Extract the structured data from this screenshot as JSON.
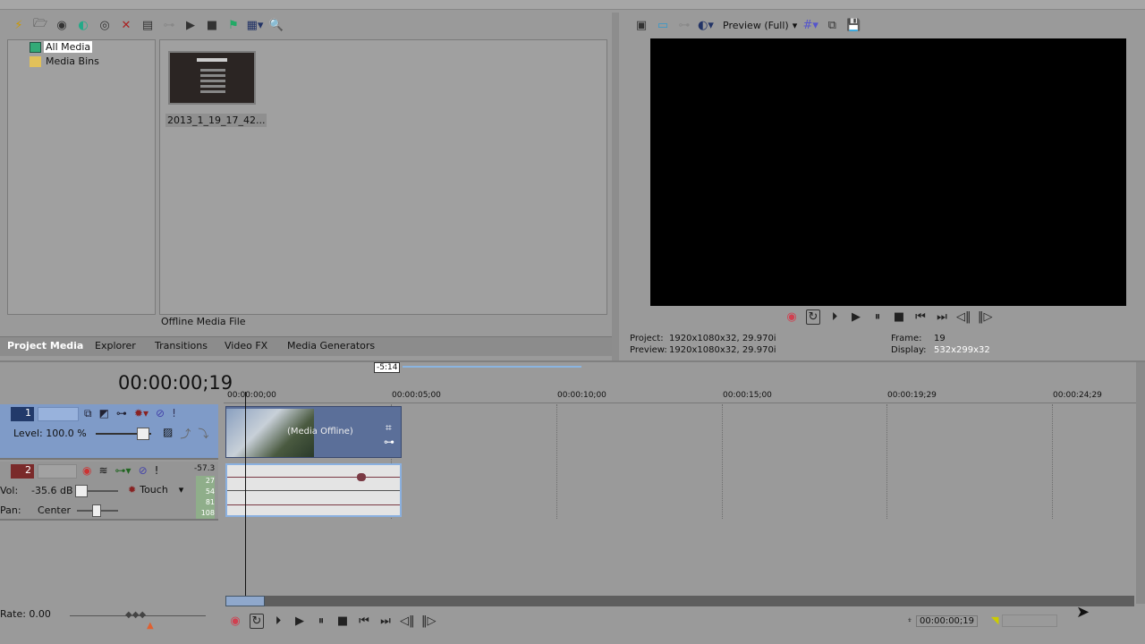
{
  "media": {
    "tree": [
      "All Media",
      "Media Bins"
    ],
    "thumbnail_label": "2013_1_19_17_42...",
    "status": "Offline Media File",
    "tabs": [
      "Project Media",
      "Explorer",
      "Transitions",
      "Video FX",
      "Media Generators"
    ]
  },
  "preview": {
    "mode": "Preview (Full)",
    "project_label": "Project:",
    "project_value": "1920x1080x32, 29.970i",
    "preview_label": "Preview:",
    "preview_value": "1920x1080x32, 29.970i",
    "frame_label": "Frame:",
    "frame_value": "19",
    "display_label": "Display:",
    "display_value": "532x299x32"
  },
  "timeline": {
    "time": "00:00:00;19",
    "selection_length": "-5:14",
    "ruler": [
      "00:00:00;00",
      "00:00:05;00",
      "00:00:10;00",
      "00:00:15;00",
      "00:00:19;29",
      "00:00:24;29"
    ],
    "video_track": {
      "number": "1",
      "level": "Level: 100.0 %"
    },
    "audio_track": {
      "number": "2",
      "vol_label": "Vol:",
      "vol_value": "-35.6 dB",
      "automation": "Touch",
      "pan_label": "Pan:",
      "pan_value": "Center",
      "meter_peak": "-57.3",
      "meter_scale": [
        "27",
        "54",
        "81",
        "108"
      ]
    },
    "clip_label": "(Media Offline)",
    "rate": "Rate: 0.00",
    "cursor_time": "00:00:00;19"
  },
  "colors": {
    "video_track": "#7f9bc8",
    "audio_track_num": "#7a2a2a",
    "record": "#d04050"
  }
}
